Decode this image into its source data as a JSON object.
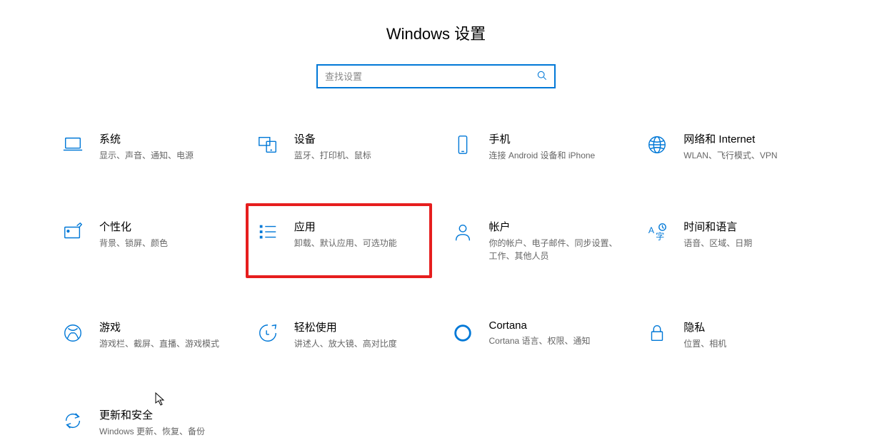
{
  "title": "Windows 设置",
  "search": {
    "placeholder": "查找设置"
  },
  "tiles": [
    {
      "title": "系统",
      "desc": "显示、声音、通知、电源"
    },
    {
      "title": "设备",
      "desc": "蓝牙、打印机、鼠标"
    },
    {
      "title": "手机",
      "desc": "连接 Android 设备和 iPhone"
    },
    {
      "title": "网络和 Internet",
      "desc": "WLAN、飞行模式、VPN"
    },
    {
      "title": "个性化",
      "desc": "背景、锁屏、颜色"
    },
    {
      "title": "应用",
      "desc": "卸载、默认应用、可选功能"
    },
    {
      "title": "帐户",
      "desc": "你的帐户、电子邮件、同步设置、工作、其他人员"
    },
    {
      "title": "时间和语言",
      "desc": "语音、区域、日期"
    },
    {
      "title": "游戏",
      "desc": "游戏栏、截屏、直播、游戏模式"
    },
    {
      "title": "轻松使用",
      "desc": "讲述人、放大镜、高对比度"
    },
    {
      "title": "Cortana",
      "desc": "Cortana 语言、权限、通知"
    },
    {
      "title": "隐私",
      "desc": "位置、相机"
    },
    {
      "title": "更新和安全",
      "desc": "Windows 更新、恢复、备份"
    }
  ]
}
